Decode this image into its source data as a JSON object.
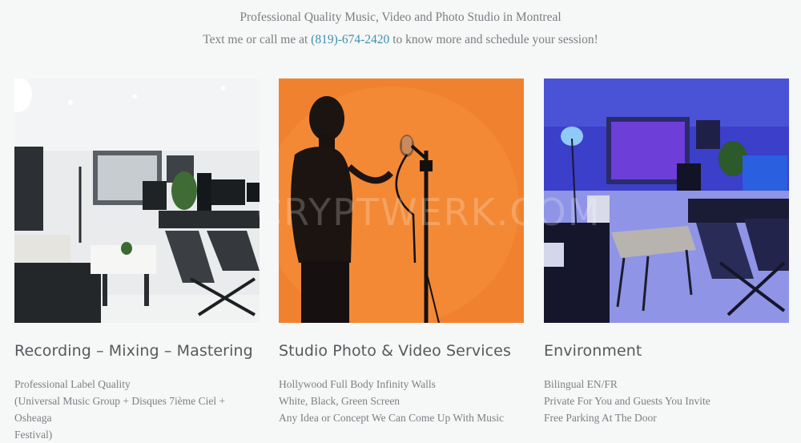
{
  "intro": {
    "line1": "Professional Quality Music, Video and Photo Studio in Montreal",
    "line2_before": "Text me or call me at ",
    "phone": "(819)-674-2420",
    "line2_after": " to know more and schedule your session!"
  },
  "watermark": "CRYPTWERK.COM",
  "columns": [
    {
      "title": "Recording – Mixing – Mastering",
      "lines": [
        "Professional Label Quality",
        "(Universal Music Group + Disques 7ième Ciel + Osheaga",
        "Festival)"
      ]
    },
    {
      "title": "Studio Photo & Video Services",
      "lines": [
        "Hollywood Full Body Infinity Walls",
        "White, Black, Green Screen",
        "Any Idea or Concept We Can Come Up With Music"
      ]
    },
    {
      "title": "Environment",
      "lines": [
        "Bilingual EN/FR",
        "Private For You and Guests You Invite",
        "Free Parking At The Door"
      ]
    }
  ],
  "colors": {
    "link": "#3e8fb0",
    "orange_wall": "#f0822f",
    "blue_room": "#3b3fc9"
  }
}
